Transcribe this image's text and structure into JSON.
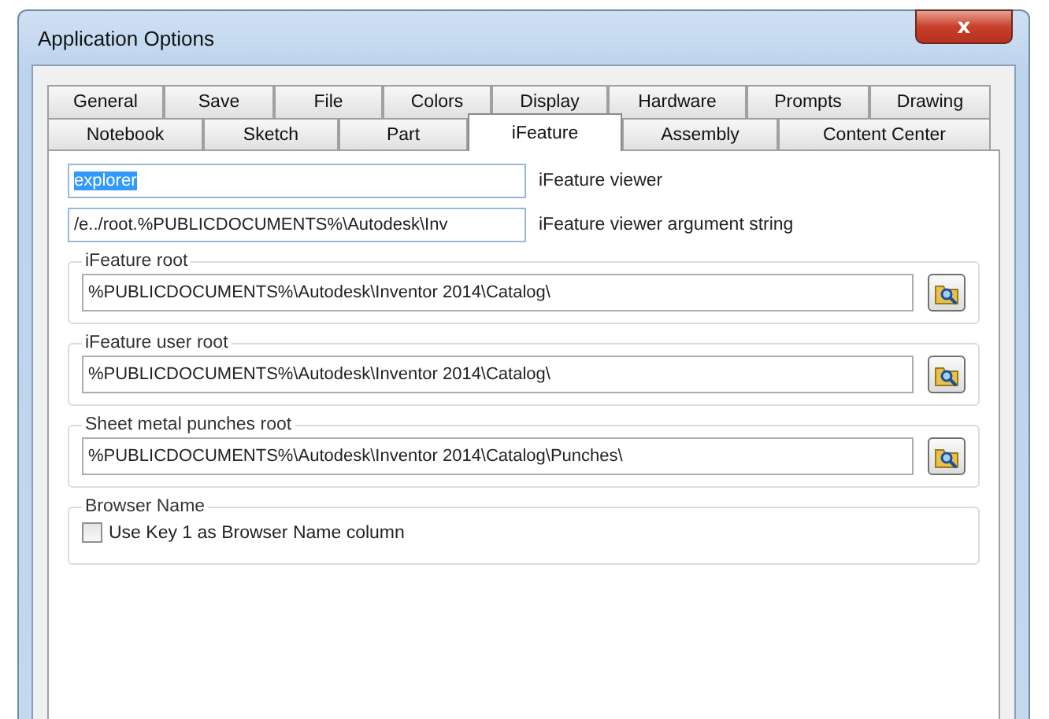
{
  "window": {
    "title": "Application Options",
    "close": "x"
  },
  "tab_rows": [
    [
      {
        "label": "General",
        "selected": false
      },
      {
        "label": "Save",
        "selected": false
      },
      {
        "label": "File",
        "selected": false
      },
      {
        "label": "Colors",
        "selected": false
      },
      {
        "label": "Display",
        "selected": false
      },
      {
        "label": "Hardware",
        "selected": false
      },
      {
        "label": "Prompts",
        "selected": false
      },
      {
        "label": "Drawing",
        "selected": false
      }
    ],
    [
      {
        "label": "Notebook",
        "selected": false
      },
      {
        "label": "Sketch",
        "selected": false
      },
      {
        "label": "Part",
        "selected": false
      },
      {
        "label": "iFeature",
        "selected": true
      },
      {
        "label": "Assembly",
        "selected": false
      },
      {
        "label": "Content Center",
        "selected": false
      }
    ]
  ],
  "viewer_fields": [
    {
      "value": "explorer",
      "text_selected": true,
      "label": "iFeature viewer"
    },
    {
      "value": "/e../root.%PUBLICDOCUMENTS%\\Autodesk\\Inv",
      "text_selected": false,
      "label": "iFeature viewer argument string"
    }
  ],
  "folder_groups": [
    {
      "title": "iFeature root",
      "path": "%PUBLICDOCUMENTS%\\Autodesk\\Inventor  2014\\Catalog\\"
    },
    {
      "title": "iFeature user root",
      "path": "%PUBLICDOCUMENTS%\\Autodesk\\Inventor  2014\\Catalog\\"
    },
    {
      "title": "Sheet metal punches root",
      "path": "%PUBLICDOCUMENTS%\\Autodesk\\Inventor  2014\\Catalog\\Punches\\"
    }
  ],
  "browser_name": {
    "title": "Browser Name",
    "checkbox": {
      "label": "Use Key 1 as Browser Name column",
      "checked": false
    }
  }
}
